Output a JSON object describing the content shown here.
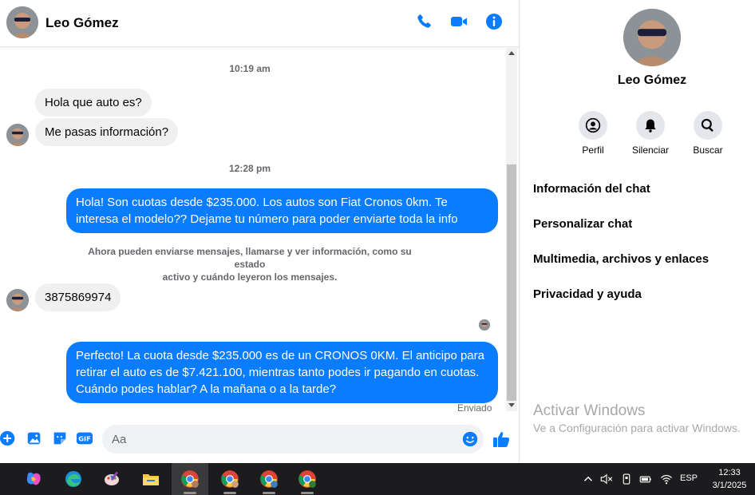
{
  "contact": {
    "name": "Leo Gómez"
  },
  "messages": {
    "timestamp1": "10:19 am",
    "msg1": "Hola que auto es?",
    "msg2": "Me pasas información?",
    "timestamp2": "12:28 pm",
    "msg3": "Hola! Son cuotas desde $235.000. Los autos son Fiat Cronos 0km. Te interesa el modelo?? Dejame tu número para poder enviarte toda la info",
    "notice_line1": "Ahora pueden enviarse mensajes, llamarse y ver información, como su estado",
    "notice_line2": "activo y cuándo leyeron los mensajes.",
    "msg4": "3875869974",
    "msg5": "Perfecto! La cuota desde $235.000 es de un CRONOS 0KM. El anticipo para retirar el auto es de $7.421.100, mientras tanto podes ir pagando en cuotas. Cuándo podes hablar? A la mañana o a la tarde?",
    "status": "Enviado"
  },
  "composer": {
    "placeholder": "Aa",
    "value": ""
  },
  "info_panel": {
    "name": "Leo Gómez",
    "actions": [
      {
        "label": "Perfil",
        "icon": "profile-icon"
      },
      {
        "label": "Silenciar",
        "icon": "bell-icon"
      },
      {
        "label": "Buscar",
        "icon": "search-icon"
      }
    ],
    "menu": [
      "Información del chat",
      "Personalizar chat",
      "Multimedia, archivos y enlaces",
      "Privacidad y ayuda"
    ],
    "watermark_title": "Activar Windows",
    "watermark_sub": "Ve a Configuración para activar Windows."
  },
  "taskbar": {
    "apps": [
      "copilot-icon",
      "edge-icon",
      "paint-icon",
      "file-explorer-icon",
      "chrome-icon",
      "chrome-icon",
      "chrome-icon",
      "chrome-icon"
    ],
    "language": "ESP",
    "time": "12:33",
    "date": "3/1/2025"
  },
  "colors": {
    "accent": "#0a7cff",
    "incoming_bubble": "#f0f0f0",
    "taskbar": "#1c1c1e"
  }
}
